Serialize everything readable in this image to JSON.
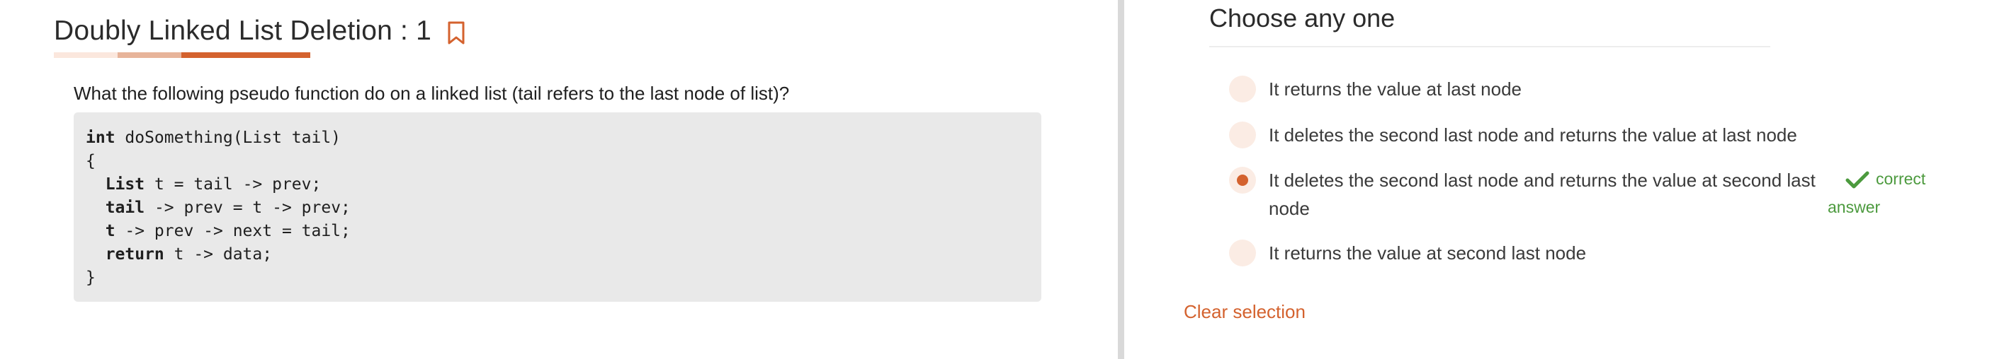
{
  "question_header": {
    "title": "Doubly Linked List Deletion : 1",
    "bookmark_icon": "bookmark-icon"
  },
  "question": {
    "text": "What the following pseudo function do on a linked list (tail refers to the last node of list)?",
    "code_lines": [
      {
        "bold": "int",
        "rest": " doSomething(List tail)"
      },
      {
        "bold": "",
        "rest": "{"
      },
      {
        "bold": "  List",
        "rest": " t = tail -> prev;"
      },
      {
        "bold": "  tail",
        "rest": " -> prev = t -> prev;"
      },
      {
        "bold": "  t",
        "rest": " -> prev -> next = tail;"
      },
      {
        "bold": "  return",
        "rest": " t -> data;"
      },
      {
        "bold": "",
        "rest": "}"
      }
    ]
  },
  "answers": {
    "heading": "Choose any one",
    "options": [
      {
        "label": "It returns the value at last node",
        "selected": false
      },
      {
        "label": "It deletes the second last node and returns the value at last node",
        "selected": false
      },
      {
        "label": "It deletes the second last node and returns the value at second last node",
        "selected": true
      },
      {
        "label": "It returns the value at second last node",
        "selected": false
      }
    ],
    "correct_label_line1": "correct",
    "correct_label_line2": "answer",
    "clear_selection": "Clear selection"
  },
  "colors": {
    "accent": "#d4622e",
    "correct": "#4c9a3e",
    "radio_bg": "#fbece4",
    "code_bg": "#e9e9e9"
  }
}
